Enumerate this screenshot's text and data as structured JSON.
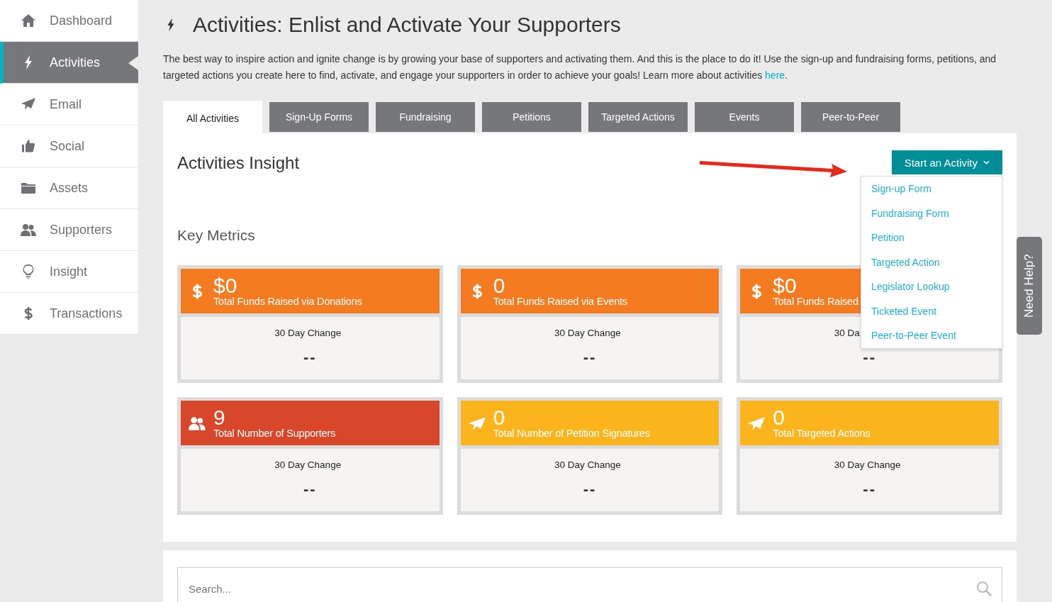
{
  "sidebar": {
    "items": [
      {
        "label": "Dashboard",
        "selected": false
      },
      {
        "label": "Activities",
        "selected": true
      },
      {
        "label": "Email",
        "selected": false
      },
      {
        "label": "Social",
        "selected": false
      },
      {
        "label": "Assets",
        "selected": false
      },
      {
        "label": "Supporters",
        "selected": false
      },
      {
        "label": "Insight",
        "selected": false
      },
      {
        "label": "Transactions",
        "selected": false
      }
    ]
  },
  "page": {
    "title": "Activities: Enlist and Activate Your Supporters",
    "description": "The best way to inspire action and ignite change is by growing your base of supporters and activating them. And this is the place to do it! Use the sign-up and fundraising forms, petitions, and targeted actions you create here to find, activate, and engage your supporters in order to achieve your goals! Learn more about activities",
    "link": "here",
    "link_end": "."
  },
  "tabs": [
    {
      "label": "All Activities",
      "selected": true
    },
    {
      "label": "Sign-Up Forms",
      "selected": false
    },
    {
      "label": "Fundraising",
      "selected": false
    },
    {
      "label": "Petitions",
      "selected": false
    },
    {
      "label": "Targeted Actions",
      "selected": false
    },
    {
      "label": "Events",
      "selected": false
    },
    {
      "label": "Peer-to-Peer",
      "selected": false
    }
  ],
  "insight": {
    "title": "Activities Insight",
    "button": "Start an Activity",
    "menu": [
      "Sign-up Form",
      "Fundraising Form",
      "Petition",
      "Targeted Action",
      "Legislator Lookup",
      "Ticketed Event",
      "Peer-to-Peer Event"
    ]
  },
  "key_metrics": {
    "title": "Key Metrics",
    "cards": [
      {
        "kind": "dollar",
        "color": "#f47b20",
        "value": "$0",
        "label": "Total Funds Raised via Donations",
        "change_label": "30 Day Change",
        "change": "--"
      },
      {
        "kind": "dollar",
        "color": "#f47b20",
        "value": "0",
        "label": "Total Funds Raised via Events",
        "change_label": "30 Day Change",
        "change": "--"
      },
      {
        "kind": "dollar",
        "color": "#f47b20",
        "value": "$0",
        "label": "Total Funds Raised",
        "change_label": "30 Da",
        "change": "--"
      },
      {
        "kind": "people",
        "color": "#d9472b",
        "value": "9",
        "label": "Total Number of Supporters",
        "change_label": "30 Day Change",
        "change": "--"
      },
      {
        "kind": "plane",
        "color": "#fbb41c",
        "value": "0",
        "label": "Total Number of Petition Signatures",
        "change_label": "30 Day Change",
        "change": "--"
      },
      {
        "kind": "plane",
        "color": "#fbb41c",
        "value": "0",
        "label": "Total Targeted Actions",
        "change_label": "30 Day Change",
        "change": "--"
      }
    ]
  },
  "search": {
    "placeholder": "Search..."
  },
  "help_tab": "Need Help?"
}
